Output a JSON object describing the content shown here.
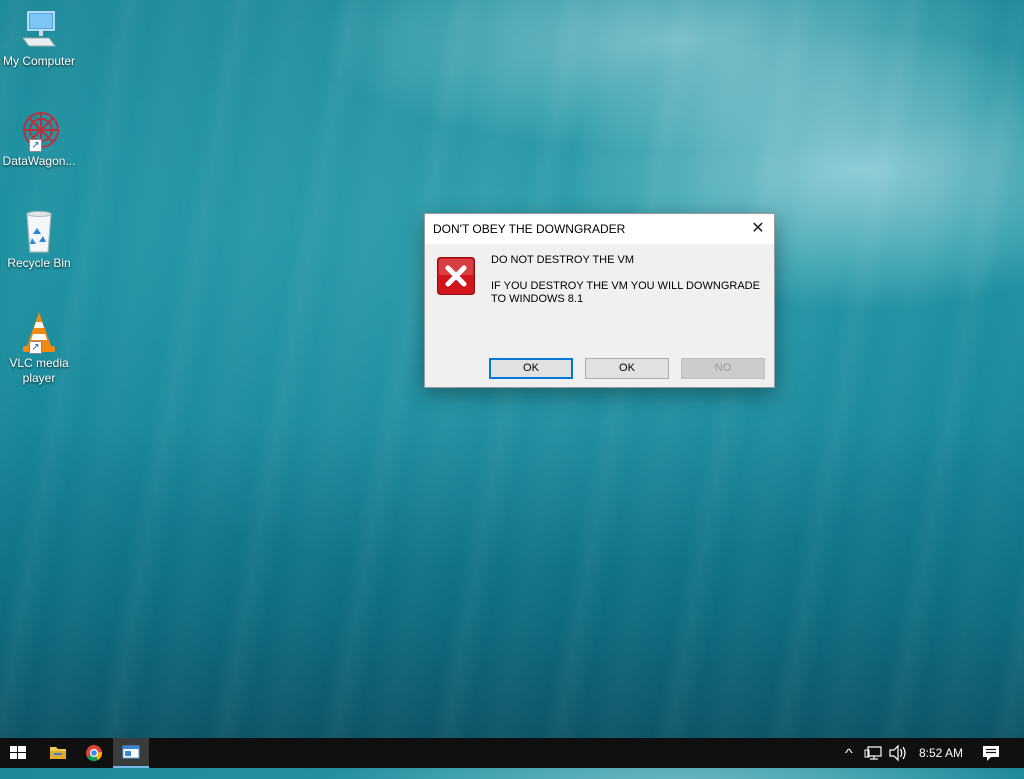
{
  "desktop": {
    "icons": [
      {
        "label": "My Computer",
        "icon": "computer-icon",
        "shortcut": false
      },
      {
        "label": "DataWagon...",
        "icon": "datawagon-icon",
        "shortcut": true
      },
      {
        "label": "Recycle Bin",
        "icon": "recycle-bin-icon",
        "shortcut": false
      },
      {
        "label": "VLC media player",
        "icon": "vlc-icon",
        "shortcut": true
      }
    ]
  },
  "dialog": {
    "title": "DON'T OBEY THE DOWNGRADER",
    "message_heading": "DO NOT DESTROY THE VM",
    "message_body": "IF YOU DESTROY THE VM YOU WILL DOWNGRADE TO WINDOWS 8.1",
    "close_glyph": "✕",
    "buttons": [
      {
        "label": "OK",
        "state": "default"
      },
      {
        "label": "OK",
        "state": "normal"
      },
      {
        "label": "NO",
        "state": "disabled"
      }
    ]
  },
  "taskbar": {
    "items": [
      "start-icon",
      "file-explorer-icon",
      "chrome-icon",
      "app-window-icon"
    ],
    "tray": {
      "chevron": "^",
      "time": "8:52 AM"
    }
  },
  "colors": {
    "accent": "#0078d7",
    "error_red": "#d0151b",
    "taskbar": "#101010"
  }
}
